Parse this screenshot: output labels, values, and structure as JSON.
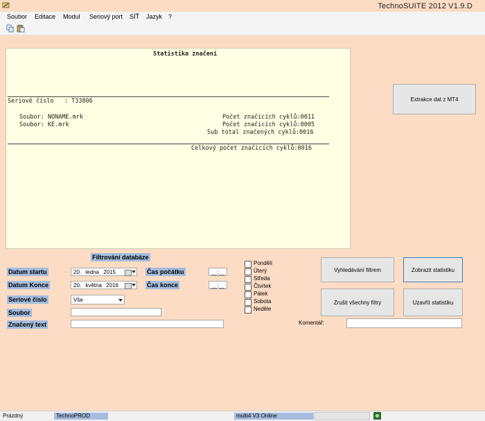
{
  "window": {
    "title": "TechnoSUITE 2012 V1.9.D"
  },
  "menu": [
    "Soubor",
    "Editace",
    "Modul",
    "Seriový port",
    "SÍŤ",
    "Jazyk",
    "?"
  ],
  "toolbar": {
    "icons": [
      "copy-icon",
      "paste-icon"
    ]
  },
  "report": {
    "title": "Statistika značení",
    "serial_line": "Seriové číslo   : T33806",
    "file1": "Soubor: NONAME.mrk",
    "count1": "Počet značicích cyklů:0011",
    "file2": "Soubor: KE.mrk",
    "count2": "Počet značicích cyklů:0005",
    "subtotal": "Sub total značených cyklů:0016",
    "total": "Celkový počet značicích cyklů:0016"
  },
  "buttons": {
    "extract": "Extrakce dat z MT4",
    "search_filter": "Vyhledávání filtrem",
    "show_stats": "Zobrazit statistiku",
    "cancel_filters": "Zrušit všechny filtry",
    "close_stats": "Uzavřít statistiku"
  },
  "filter": {
    "heading": "Filtrování databáze",
    "start_date_label": "Datum startu",
    "start_date": {
      "day": "20.",
      "month": "ledna",
      "year": "2015"
    },
    "end_date_label": "Datum Konce",
    "end_date": {
      "day": "20.",
      "month": "května",
      "year": "2016"
    },
    "start_time_label": "Čas počátku",
    "start_time": "__:__",
    "end_time_label": "Čas konce",
    "end_time": "__:__",
    "serial_label": "Seriové číslo",
    "serial_value": "Vše",
    "file_label": "Soubor",
    "file_value": "",
    "marked_text_label": "Značený text",
    "marked_text_value": "",
    "days": [
      "Pondělí",
      "Úterý",
      "Středa",
      "Čtvrtek",
      "Pátek",
      "Sobota",
      "Neděle"
    ]
  },
  "comment": {
    "label": "Komentář:",
    "value": ""
  },
  "status": {
    "state": "Prázdný",
    "product": "TechnoPROD",
    "connection": "multi4 V3 Online"
  }
}
